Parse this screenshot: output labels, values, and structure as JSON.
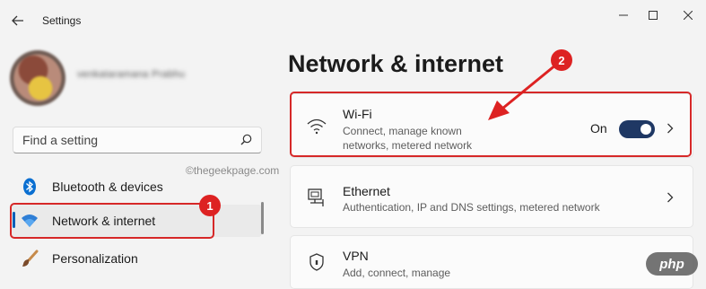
{
  "window": {
    "title": "Settings"
  },
  "profile": {
    "name": "venkataramana Prabhu"
  },
  "search": {
    "placeholder": "Find a setting"
  },
  "watermark": "©thegeekpage.com",
  "sidebar": {
    "items": [
      {
        "label": "Bluetooth & devices",
        "icon": "bluetooth-icon"
      },
      {
        "label": "Network & internet",
        "icon": "wifi-icon",
        "active": true
      },
      {
        "label": "Personalization",
        "icon": "brush-icon"
      }
    ]
  },
  "main": {
    "heading": "Network & internet",
    "cards": [
      {
        "title": "Wi-Fi",
        "description": "Connect, manage known networks, metered network",
        "toggle_label": "On",
        "toggle_on": true,
        "icon": "wifi-icon"
      },
      {
        "title": "Ethernet",
        "description": "Authentication, IP and DNS settings, metered network",
        "icon": "ethernet-icon"
      },
      {
        "title": "VPN",
        "description": "Add, connect, manage",
        "icon": "shield-icon"
      }
    ]
  },
  "annotations": {
    "badge_1": "1",
    "badge_2": "2"
  },
  "logo": "php",
  "colors": {
    "accent": "#005fb8",
    "toggle": "#1f3864",
    "annotation": "#d62828"
  }
}
